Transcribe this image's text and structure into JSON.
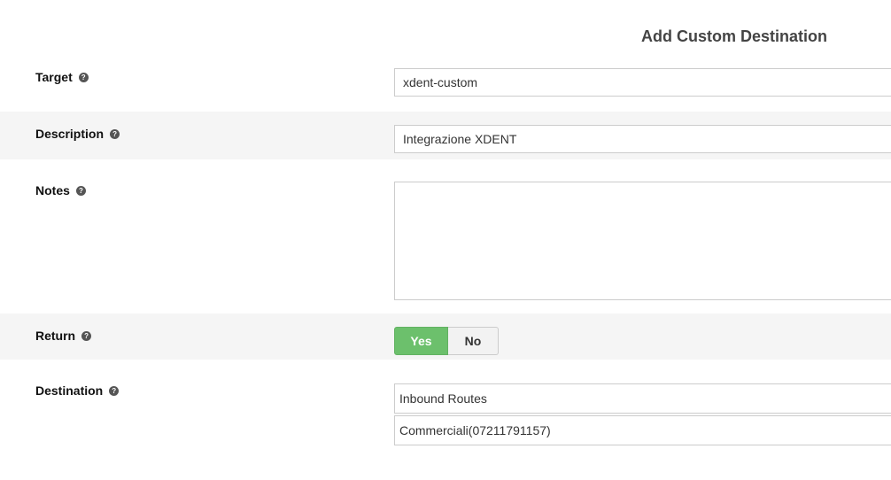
{
  "header": {
    "title": "Add Custom Destination"
  },
  "form": {
    "target": {
      "label": "Target",
      "value": "xdent-custom"
    },
    "description": {
      "label": "Description",
      "value": "Integrazione XDENT"
    },
    "notes": {
      "label": "Notes",
      "value": ""
    },
    "return": {
      "label": "Return",
      "yes_label": "Yes",
      "no_label": "No",
      "selected": "Yes"
    },
    "destination": {
      "label": "Destination",
      "category": "Inbound Routes",
      "target": "Commerciali(07211791157)"
    }
  },
  "icons": {
    "help": "question-circle-icon"
  },
  "colors": {
    "toggle_active": "#6cc06c",
    "row_shade": "#f5f5f5"
  }
}
